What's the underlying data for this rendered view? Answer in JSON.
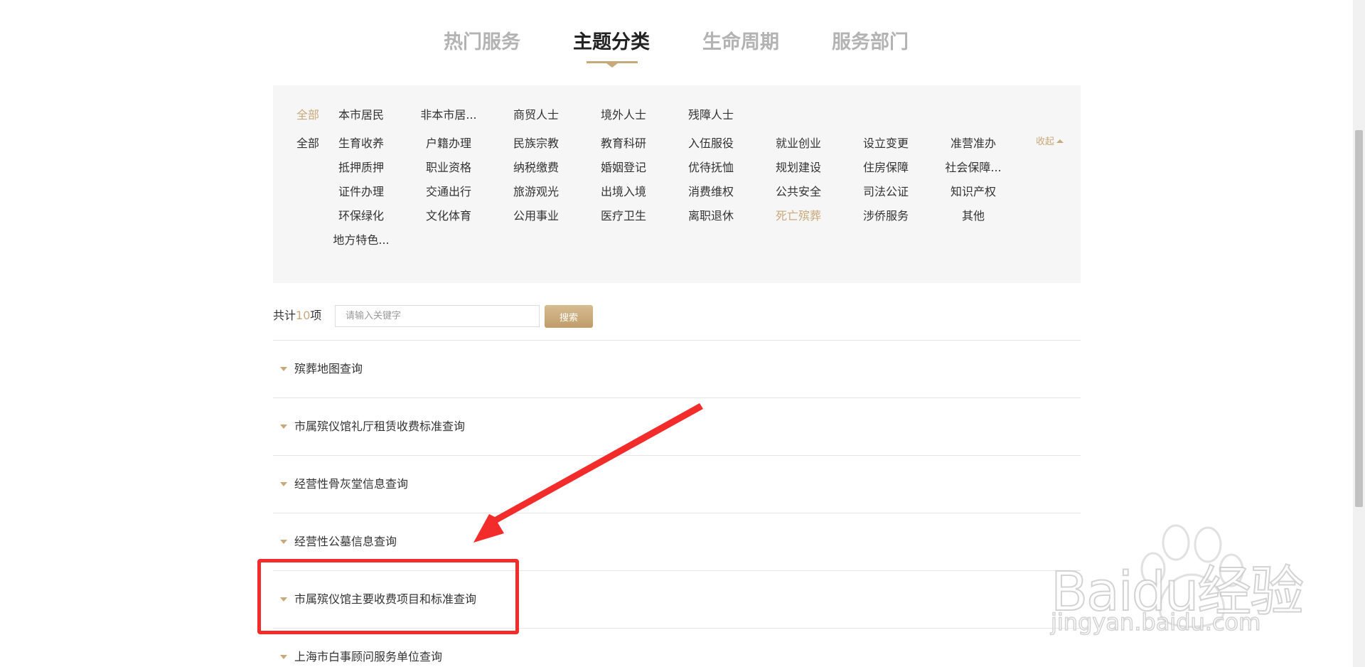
{
  "tabs": [
    {
      "label": "热门服务",
      "active": false
    },
    {
      "label": "主题分类",
      "active": true
    },
    {
      "label": "生命周期",
      "active": false
    },
    {
      "label": "服务部门",
      "active": false
    }
  ],
  "filters": {
    "audience_all": "全部",
    "audience": [
      "本市居民",
      "非本市居...",
      "商贸人士",
      "境外人士",
      "残障人士"
    ],
    "topic_all": "全部",
    "topics": [
      "生育收养",
      "户籍办理",
      "民族宗教",
      "教育科研",
      "入伍服役",
      "就业创业",
      "设立变更",
      "准营准办",
      "抵押质押",
      "职业资格",
      "纳税缴费",
      "婚姻登记",
      "优待抚恤",
      "规划建设",
      "住房保障",
      "社会保障...",
      "证件办理",
      "交通出行",
      "旅游观光",
      "出境入境",
      "消费维权",
      "公共安全",
      "司法公证",
      "知识产权",
      "环保绿化",
      "文化体育",
      "公用事业",
      "医疗卫生",
      "离职退休",
      "死亡殡葬",
      "涉侨服务",
      "其他",
      "地方特色..."
    ],
    "selected_topic": "死亡殡葬",
    "collapse_label": "收起"
  },
  "search": {
    "count_prefix": "共计",
    "count_value": "10",
    "count_suffix": "项",
    "placeholder": "请输入关键字",
    "button_label": "搜索"
  },
  "results": [
    "殡葬地图查询",
    "市属殡仪馆礼厅租赁收费标准查询",
    "经营性骨灰堂信息查询",
    "经营性公墓信息查询",
    "市属殡仪馆主要收费项目和标准查询",
    "上海市白事顾问服务单位查询"
  ],
  "colors": {
    "accent": "#c8a97a",
    "annotation": "#f22b2b"
  },
  "watermark": {
    "brand": "Baidu经验",
    "url": "jingyan.baidu.com"
  }
}
